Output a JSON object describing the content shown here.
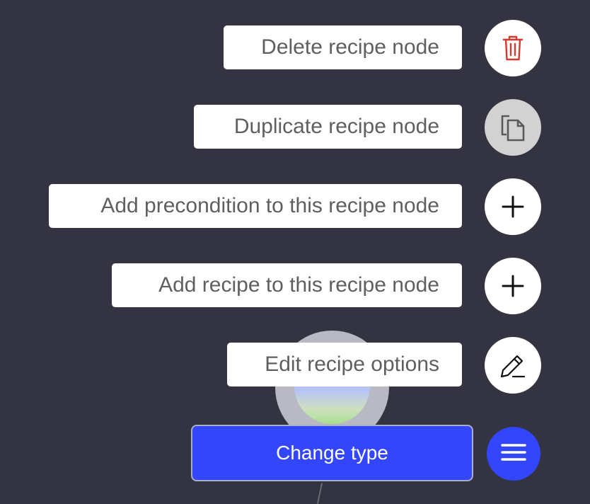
{
  "menu": {
    "items": [
      {
        "label": "Delete recipe node",
        "icon": "trash-icon",
        "icon_color": "#d43b2f",
        "enabled": true
      },
      {
        "label": "Duplicate recipe node",
        "icon": "copy-icon",
        "icon_color": "#5a5a5a",
        "enabled": false
      },
      {
        "label": "Add precondition to this recipe node",
        "icon": "plus-icon",
        "icon_color": "#111111",
        "enabled": true
      },
      {
        "label": "Add recipe to this recipe node",
        "icon": "plus-icon",
        "icon_color": "#111111",
        "enabled": true
      },
      {
        "label": "Edit recipe options",
        "icon": "pencil-icon",
        "icon_color": "#111111",
        "enabled": true
      }
    ]
  },
  "change_type": {
    "label": "Change type"
  },
  "fab": {
    "icon": "menu-icon"
  },
  "colors": {
    "background": "#333341",
    "accent": "#3346fb",
    "danger": "#d43b2f"
  }
}
